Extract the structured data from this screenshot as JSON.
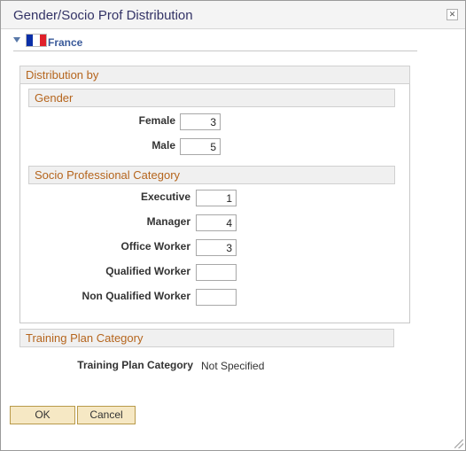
{
  "dialog": {
    "title": "Gender/Socio Prof Distribution",
    "close_glyph": "✕"
  },
  "country": {
    "name": "France",
    "collapse_icon": "triangle-down-icon",
    "flag_colors": [
      "#0b2fa8",
      "#ffffff",
      "#e0202a"
    ]
  },
  "distribution": {
    "header": "Distribution by",
    "gender": {
      "header": "Gender",
      "fields": [
        {
          "label": "Female",
          "value": "3"
        },
        {
          "label": "Male",
          "value": "5"
        }
      ]
    },
    "socio": {
      "header": "Socio Professional Category",
      "fields": [
        {
          "label": "Executive",
          "value": "1"
        },
        {
          "label": "Manager",
          "value": "4"
        },
        {
          "label": "Office Worker",
          "value": "3"
        },
        {
          "label": "Qualified Worker",
          "value": ""
        },
        {
          "label": "Non Qualified Worker",
          "value": ""
        }
      ]
    }
  },
  "training": {
    "header": "Training Plan Category",
    "label": "Training Plan Category",
    "value": "Not Specified"
  },
  "buttons": {
    "ok": "OK",
    "cancel": "Cancel"
  },
  "colors": {
    "section_header_text": "#b5651d",
    "country_text": "#3a5a9a",
    "button_fill": "#f6e8c4"
  }
}
